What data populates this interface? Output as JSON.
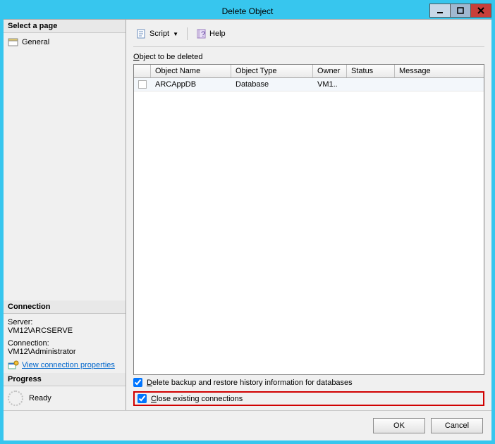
{
  "window": {
    "title": "Delete Object"
  },
  "sidebar": {
    "select_page_header": "Select a page",
    "pages": [
      {
        "label": "General"
      }
    ],
    "connection_header": "Connection",
    "server_label": "Server:",
    "server_value": "VM12\\ARCSERVE",
    "conn_label": "Connection:",
    "conn_value": "VM12\\Administrator",
    "view_conn_link": "View connection properties",
    "progress_header": "Progress",
    "progress_text": "Ready"
  },
  "toolbar": {
    "script_label": "Script",
    "help_label": "Help"
  },
  "main": {
    "list_caption": "Object to be deleted",
    "caption_ul": "O",
    "columns": {
      "name": "Object Name",
      "type": "Object Type",
      "owner": "Owner",
      "status": "Status",
      "message": "Message"
    },
    "rows": [
      {
        "name": "ARCAppDB",
        "type": "Database",
        "owner": "VM1..",
        "status": "",
        "message": ""
      }
    ],
    "cb1_ul": "D",
    "cb1_rest": "elete backup and restore history information for databases",
    "cb1_checked": true,
    "cb2_ul": "C",
    "cb2_rest": "lose existing connections",
    "cb2_checked": true
  },
  "buttons": {
    "ok": "OK",
    "cancel": "Cancel"
  }
}
